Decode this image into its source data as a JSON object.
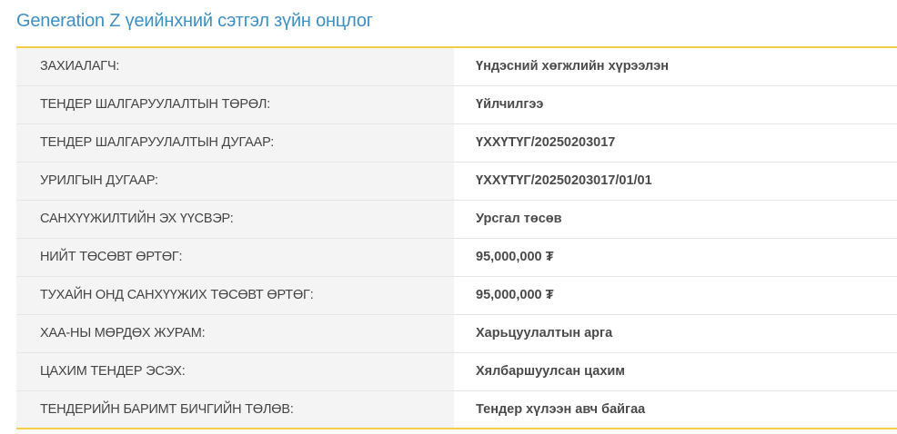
{
  "page": {
    "title": "Generation Z үеийнхний сэтгэл зүйн онцлог"
  },
  "details": {
    "rows": [
      {
        "label": "ЗАХИАЛАГЧ:",
        "value": "Үндэсний хөгжлийн хүрээлэн"
      },
      {
        "label": "ТЕНДЕР ШАЛГАРУУЛАЛТЫН ТӨРӨЛ:",
        "value": "Үйлчилгээ"
      },
      {
        "label": "ТЕНДЕР ШАЛГАРУУЛАЛТЫН ДУГААР:",
        "value": "ҮХХҮТҮГ/20250203017"
      },
      {
        "label": "УРИЛГЫН ДУГААР:",
        "value": "ҮХХҮТҮГ/20250203017/01/01"
      },
      {
        "label": "САНХҮҮЖИЛТИЙН ЭХ ҮҮСВЭР:",
        "value": "Урсгал төсөв"
      },
      {
        "label": "НИЙТ ТӨСӨВТ ӨРТӨГ:",
        "value": "95,000,000 ₮"
      },
      {
        "label": "ТУХАЙН ОНД САНХҮҮЖИХ ТӨСӨВТ ӨРТӨГ:",
        "value": "95,000,000 ₮"
      },
      {
        "label": "ХАА-НЫ МӨРДӨХ ЖУРАМ:",
        "value": "Харьцуулалтын арга"
      },
      {
        "label": "ЦАХИМ ТЕНДЕР ЭСЭХ:",
        "value": "Хялбаршуулсан цахим"
      },
      {
        "label": "ТЕНДЕРИЙН БАРИМТ БИЧГИЙН ТӨЛӨВ:",
        "value": "Тендер хүлээн авч байгаа"
      }
    ]
  },
  "colors": {
    "title": "#3d8fc0",
    "border_accent": "#f3cc48",
    "label_background": "#f4f4f4",
    "row_divider": "#e6e6e6",
    "text": "#444444"
  }
}
